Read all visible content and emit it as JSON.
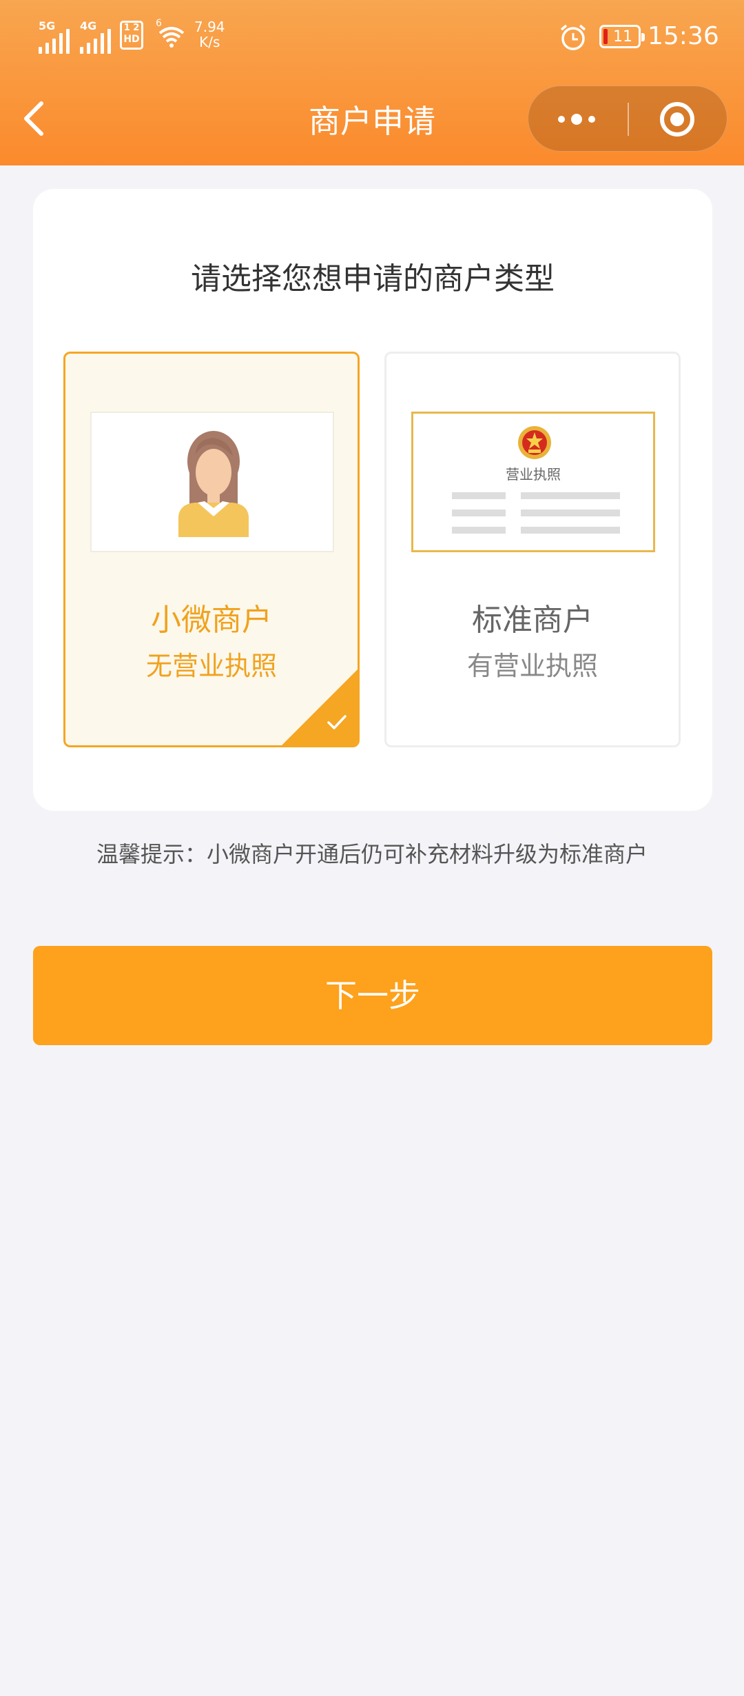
{
  "status_bar": {
    "sig1_label": "5G",
    "sig2_label": "4G",
    "hd_label": "HD",
    "sim_numbers": "1 2",
    "wifi_sup": "6",
    "net_speed_value": "7.94",
    "net_speed_unit": "K/s",
    "battery_level": "11",
    "time": "15:36"
  },
  "nav": {
    "title": "商户申请"
  },
  "panel": {
    "title": "请选择您想申请的商户类型",
    "options": [
      {
        "title": "小微商户",
        "subtitle": "无营业执照",
        "selected": true
      },
      {
        "title": "标准商户",
        "subtitle": "有营业执照",
        "selected": false,
        "card_label": "营业执照"
      }
    ]
  },
  "tip": "温馨提示：小微商户开通后仍可补充材料升级为标准商户",
  "next_button": "下一步",
  "colors": {
    "accent": "#f5a623",
    "header_top": "#f8a650",
    "header_bottom": "#fb8a2c",
    "button": "#fea11c"
  }
}
